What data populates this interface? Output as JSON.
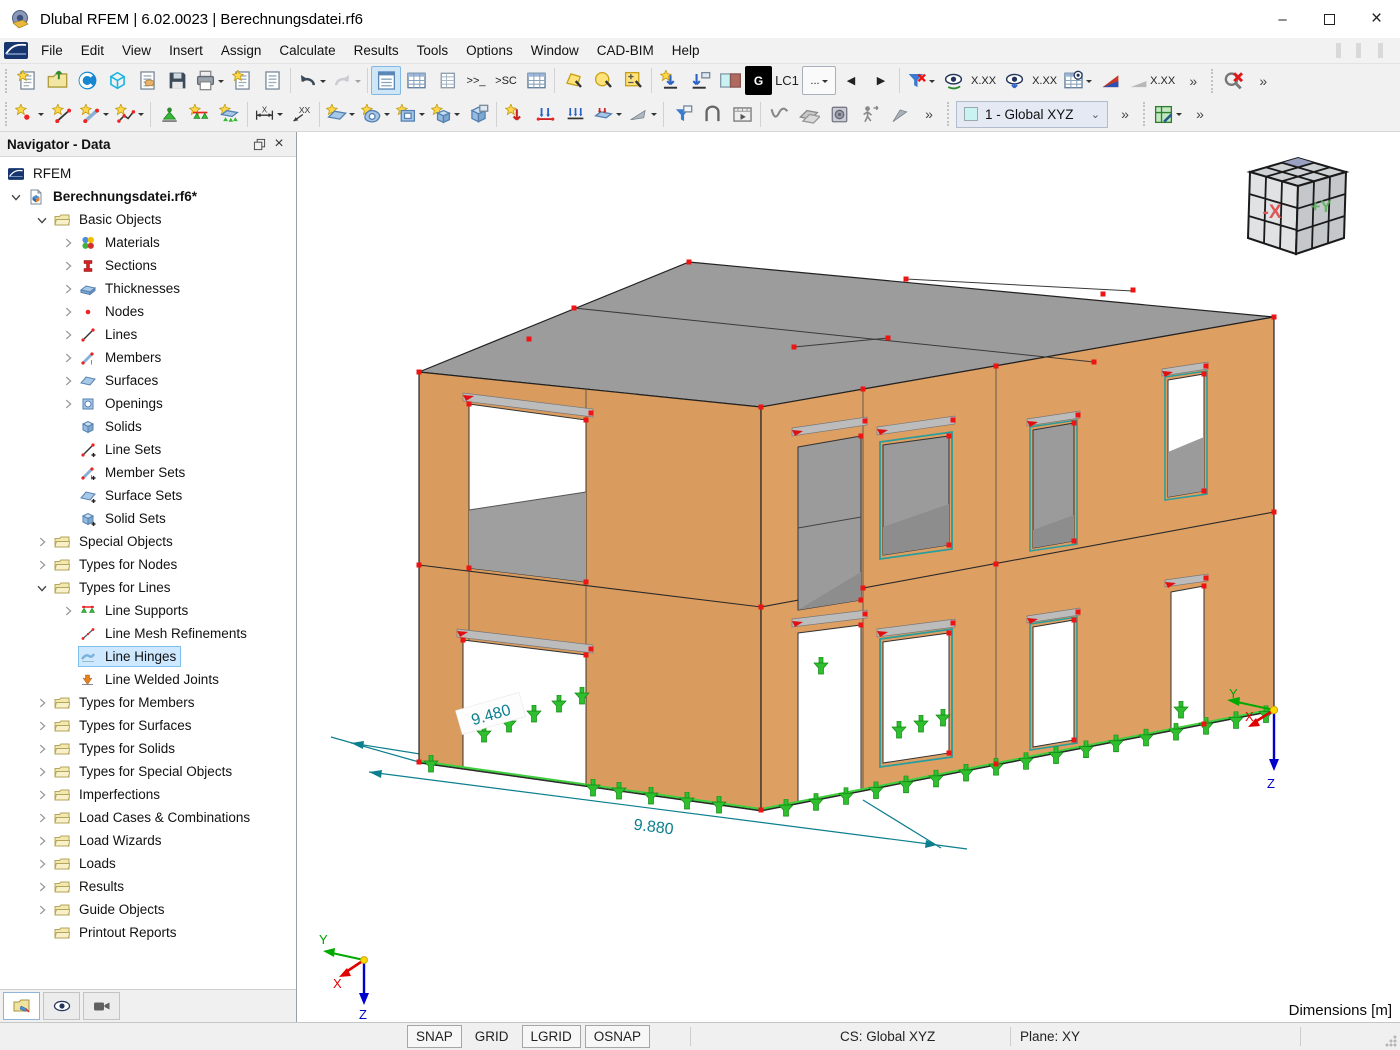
{
  "window": {
    "title": "Dlubal RFEM | 6.02.0023 | Berechnungsdatei.rf6"
  },
  "menubar": {
    "items": [
      "File",
      "Edit",
      "View",
      "Insert",
      "Assign",
      "Calculate",
      "Results",
      "Tools",
      "Options",
      "Window",
      "CAD-BIM",
      "Help"
    ]
  },
  "toolbar_main": {
    "items": [
      {
        "h": 1
      },
      {
        "n": "new-model"
      },
      {
        "n": "open-model"
      },
      {
        "n": "dlubal-center"
      },
      {
        "n": "model-browser"
      },
      {
        "n": "model-settings"
      },
      {
        "n": "save"
      },
      {
        "n": "print",
        "dd": 1
      },
      {
        "n": "new-printout-report"
      },
      {
        "n": "printout-report"
      },
      {
        "sep": 1
      },
      {
        "n": "undo",
        "dd": 1
      },
      {
        "n": "redo",
        "dd": 1,
        "dis": 1
      },
      {
        "sep": 1
      },
      {
        "n": "panel-navigator",
        "active": 1
      },
      {
        "n": "panel-tables"
      },
      {
        "n": "panel-table-small"
      },
      {
        "n": "panel-console",
        "label": ">>_"
      },
      {
        "n": "panel-sc",
        "label": ">SC"
      },
      {
        "n": "panel-table-layout"
      },
      {
        "sep": 1
      },
      {
        "n": "select-polygon"
      },
      {
        "n": "select-circle"
      },
      {
        "n": "select-numeric"
      },
      {
        "sep": 1
      },
      {
        "n": "transfer-loads"
      },
      {
        "n": "import-loads"
      },
      {
        "n": "lc-colors"
      },
      {
        "n": "lc-type",
        "label": "G"
      },
      {
        "n": "lc-current",
        "label": "LC1"
      },
      {
        "n": "lc-more",
        "label": "...",
        "dd": 1
      },
      {
        "n": "lc-prev",
        "label": "◀"
      },
      {
        "n": "lc-next",
        "label": "▶"
      },
      {
        "sep": 1
      },
      {
        "n": "filter-loads",
        "dd": 1
      },
      {
        "n": "show-loads"
      },
      {
        "n": "show-load-values",
        "label": "X.XX"
      },
      {
        "n": "show-supports"
      },
      {
        "n": "show-support-values",
        "label": "X.XX"
      },
      {
        "n": "result-table",
        "dd": 1
      },
      {
        "n": "color-ramp"
      },
      {
        "n": "value-ramp",
        "label": "X.XX"
      },
      {
        "n": "overflow-a",
        "label": "»"
      },
      {
        "h": 1
      },
      {
        "n": "zoom-cancel"
      },
      {
        "n": "overflow-b",
        "label": "»"
      }
    ]
  },
  "toolbar_insert": {
    "cs_value": "1 - Global XYZ",
    "items": [
      {
        "h": 1
      },
      {
        "n": "new-node",
        "dd": 1
      },
      {
        "n": "new-line"
      },
      {
        "n": "new-member",
        "dd": 1
      },
      {
        "n": "new-polyline",
        "dd": 1
      },
      {
        "sep": 1
      },
      {
        "n": "new-nodal-support"
      },
      {
        "n": "new-line-support"
      },
      {
        "n": "new-surface-support"
      },
      {
        "sep": 1
      },
      {
        "n": "dim-linear",
        "dd": 1
      },
      {
        "n": "dim-slope"
      },
      {
        "sep": 1
      },
      {
        "n": "new-surface",
        "dd": 1
      },
      {
        "n": "new-opening",
        "dd": 1
      },
      {
        "n": "new-rect-opening",
        "dd": 1
      },
      {
        "n": "new-solid",
        "dd": 1
      },
      {
        "n": "new-block"
      },
      {
        "sep": 1
      },
      {
        "n": "new-nodal-load"
      },
      {
        "n": "new-member-load"
      },
      {
        "n": "new-line-load"
      },
      {
        "n": "new-imposed-deformation",
        "dd": 1
      },
      {
        "n": "new-free-load",
        "dd": 1
      },
      {
        "sep": 1
      },
      {
        "n": "visibility-filter"
      },
      {
        "n": "clipping-box"
      },
      {
        "n": "animation"
      },
      {
        "sep": 1
      },
      {
        "n": "result-diagrams"
      },
      {
        "n": "result-surfaces"
      },
      {
        "n": "render-view"
      },
      {
        "n": "walk-through"
      },
      {
        "n": "pointer-mode"
      },
      {
        "n": "overflow-c",
        "label": "»"
      },
      {
        "h": 1
      },
      {
        "combo": 1
      },
      {
        "n": "overflow-d",
        "label": "»"
      },
      {
        "h": 1
      },
      {
        "n": "panel-control",
        "dd": 1
      },
      {
        "n": "overflow-e",
        "label": "»"
      }
    ]
  },
  "navigator": {
    "title": "Navigator - Data",
    "tree": [
      {
        "l": "RFEM",
        "v": 0,
        "i": "rfem",
        "ns": 1
      },
      {
        "l": "Berechnungsdatei.rf6*",
        "v": 0,
        "a": "e",
        "i": "file",
        "b": 1
      },
      {
        "l": "Basic Objects",
        "v": 1,
        "a": "e",
        "i": "folder"
      },
      {
        "l": "Materials",
        "v": 2,
        "a": "c",
        "i": "materials"
      },
      {
        "l": "Sections",
        "v": 2,
        "a": "c",
        "i": "sections"
      },
      {
        "l": "Thicknesses",
        "v": 2,
        "a": "c",
        "i": "thicknesses"
      },
      {
        "l": "Nodes",
        "v": 2,
        "a": "c",
        "i": "nodes"
      },
      {
        "l": "Lines",
        "v": 2,
        "a": "c",
        "i": "lines"
      },
      {
        "l": "Members",
        "v": 2,
        "a": "c",
        "i": "members"
      },
      {
        "l": "Surfaces",
        "v": 2,
        "a": "c",
        "i": "surfaces"
      },
      {
        "l": "Openings",
        "v": 2,
        "a": "c",
        "i": "openings"
      },
      {
        "l": "Solids",
        "v": 2,
        "i": "solids"
      },
      {
        "l": "Line Sets",
        "v": 2,
        "i": "linesets"
      },
      {
        "l": "Member Sets",
        "v": 2,
        "i": "membersets"
      },
      {
        "l": "Surface Sets",
        "v": 2,
        "i": "surfacesets"
      },
      {
        "l": "Solid Sets",
        "v": 2,
        "i": "solidsets"
      },
      {
        "l": "Special Objects",
        "v": 1,
        "a": "c",
        "i": "folder"
      },
      {
        "l": "Types for Nodes",
        "v": 1,
        "a": "c",
        "i": "folder"
      },
      {
        "l": "Types for Lines",
        "v": 1,
        "a": "e",
        "i": "folder"
      },
      {
        "l": "Line Supports",
        "v": 2,
        "a": "c",
        "i": "linesupports"
      },
      {
        "l": "Line Mesh Refinements",
        "v": 2,
        "i": "linemesh"
      },
      {
        "l": "Line Hinges",
        "v": 2,
        "i": "linehinges",
        "s": 1
      },
      {
        "l": "Line Welded Joints",
        "v": 2,
        "i": "linewelded"
      },
      {
        "l": "Types for Members",
        "v": 1,
        "a": "c",
        "i": "folder"
      },
      {
        "l": "Types for Surfaces",
        "v": 1,
        "a": "c",
        "i": "folder"
      },
      {
        "l": "Types for Solids",
        "v": 1,
        "a": "c",
        "i": "folder"
      },
      {
        "l": "Types for Special Objects",
        "v": 1,
        "a": "c",
        "i": "folder"
      },
      {
        "l": "Imperfections",
        "v": 1,
        "a": "c",
        "i": "folder"
      },
      {
        "l": "Load Cases & Combinations",
        "v": 1,
        "a": "c",
        "i": "folder"
      },
      {
        "l": "Load Wizards",
        "v": 1,
        "a": "c",
        "i": "folder"
      },
      {
        "l": "Loads",
        "v": 1,
        "a": "c",
        "i": "folder"
      },
      {
        "l": "Results",
        "v": 1,
        "a": "c",
        "i": "folder"
      },
      {
        "l": "Guide Objects",
        "v": 1,
        "a": "c",
        "i": "folder"
      },
      {
        "l": "Printout Reports",
        "v": 1,
        "i": "folder"
      }
    ]
  },
  "viewport": {
    "dim_left": "9.480",
    "dim_bottom": "9.880",
    "dimensions_label": "Dimensions [m]",
    "origin_axes": {
      "x": "X",
      "y": "Y",
      "z": "Z"
    },
    "screen_axes": {
      "x": "X",
      "y": "Y",
      "z": "Z"
    },
    "view_cube": {
      "left_face": "-X",
      "right_face": "+Y"
    }
  },
  "statusbar": {
    "toggles": [
      {
        "label": "SNAP",
        "pressed": true
      },
      {
        "label": "GRID",
        "pressed": false
      },
      {
        "label": "LGRID",
        "pressed": true
      },
      {
        "label": "OSNAP",
        "pressed": true
      }
    ],
    "cs": "CS: Global XYZ",
    "plane": "Plane: XY"
  },
  "colors": {
    "wall": "#DA9B5E",
    "roof": "#9C9C9C",
    "support": "#2EBE2E",
    "node": "#EE1414",
    "dimension": "#0B7F8E",
    "selection": "#CDE8FF",
    "accent": "#84B7E2"
  }
}
